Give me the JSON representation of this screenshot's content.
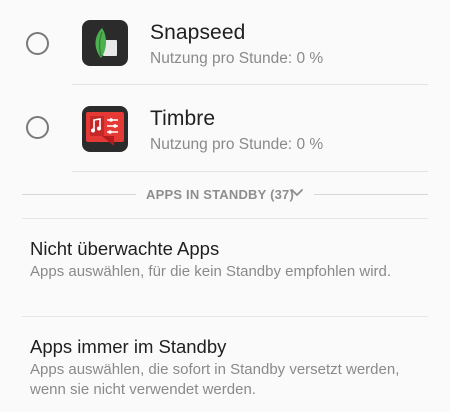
{
  "apps": [
    {
      "name": "Snapseed",
      "usage": "Nutzung pro Stunde: 0 %",
      "icon": "snapseed-leaf-icon"
    },
    {
      "name": "Timbre",
      "usage": "Nutzung pro Stunde: 0 %",
      "icon": "timbre-music-icon"
    }
  ],
  "standby_section": {
    "title": "APPS IN STANDBY (37)",
    "icon": "chevron-down-icon"
  },
  "settings": [
    {
      "title": "Nicht überwachte Apps",
      "description": "Apps auswählen, für die kein Standby empfohlen wird."
    },
    {
      "title": "Apps immer im Standby",
      "description": "Apps auswählen, die sofort in Standby versetzt werden, wenn sie nicht verwendet werden."
    }
  ],
  "colors": {
    "background": "#fafafa",
    "snapseed_icon_bg": "#2b2b2b",
    "snapseed_leaf": "#4caf50",
    "timbre_icon_bg": "#e53935",
    "secondary_text": "#8a8a8a"
  }
}
